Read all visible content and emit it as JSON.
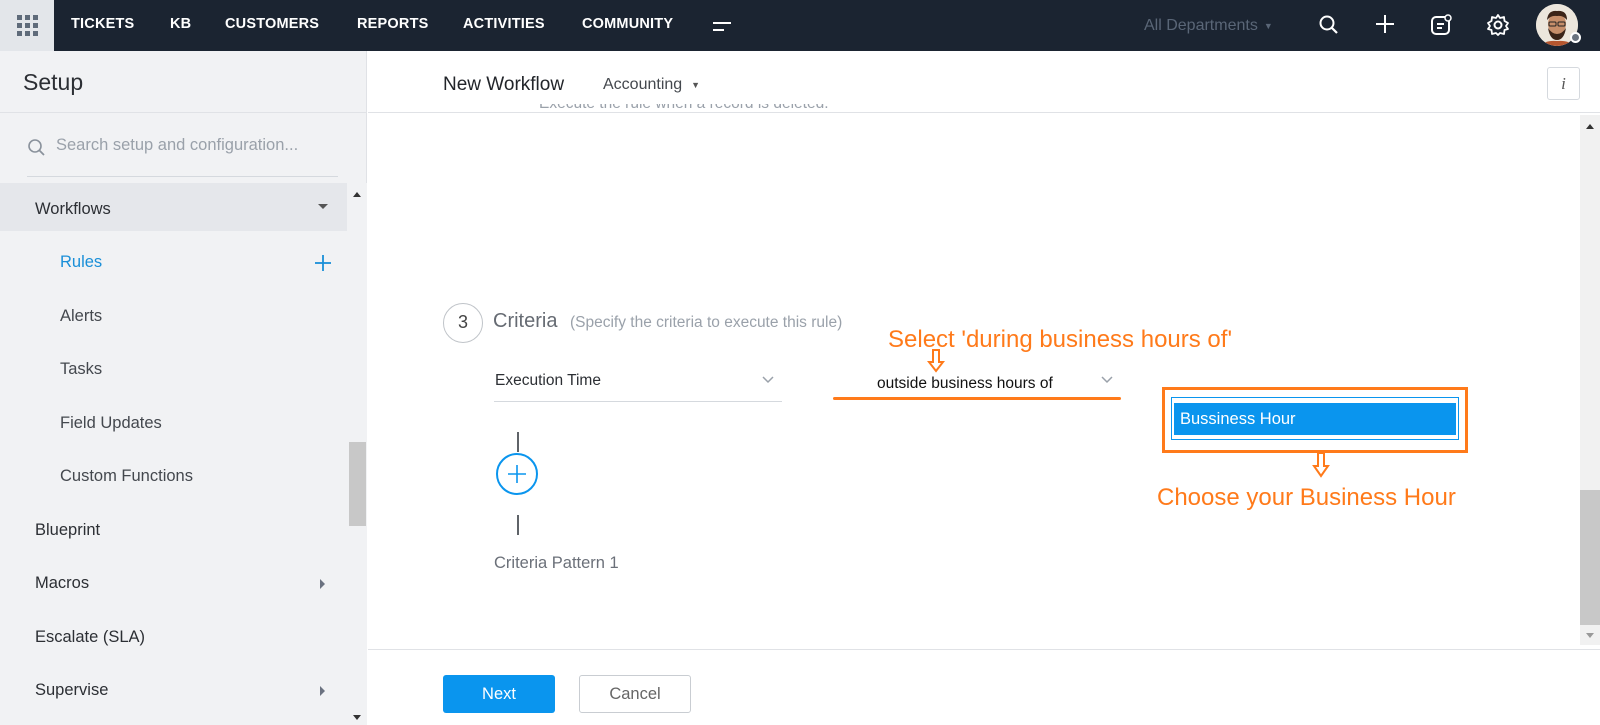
{
  "topnav": {
    "items": [
      "TICKETS",
      "KB",
      "CUSTOMERS",
      "REPORTS",
      "ACTIVITIES",
      "COMMUNITY"
    ],
    "department": "All Departments"
  },
  "sidebar": {
    "title": "Setup",
    "search_placeholder": "Search setup and configuration...",
    "section": "Workflows",
    "sub_items": [
      "Rules",
      "Alerts",
      "Tasks",
      "Field Updates",
      "Custom Functions"
    ],
    "items": [
      "Blueprint",
      "Macros",
      "Escalate (SLA)",
      "Supervise"
    ]
  },
  "header": {
    "title": "New Workflow",
    "department": "Accounting",
    "info_label": "i"
  },
  "faded_text": "Execute the rule when a record is deleted.",
  "criteria": {
    "step": "3",
    "title": "Criteria",
    "description": "(Specify the criteria to execute this rule)",
    "field": "Execution Time",
    "condition": "outside business hours of",
    "value": "Bussiness Hour",
    "pattern": "Criteria Pattern 1"
  },
  "annotations": {
    "select_hint": "Select 'during business hours of'",
    "choose_hint": "Choose your Business Hour",
    "color": "#ff7a1a"
  },
  "footer": {
    "next": "Next",
    "cancel": "Cancel"
  },
  "colors": {
    "accent": "#0a95ee",
    "topbar": "#1b2431"
  }
}
